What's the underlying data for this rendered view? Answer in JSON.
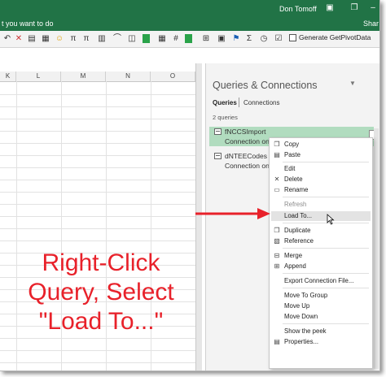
{
  "window": {
    "user_name": "Don Tomoff",
    "tell_me": "t you want to do",
    "share_label": "Shar",
    "colors": {
      "excel_green": "#217346",
      "selection_green": "#b1dcbf",
      "annotation_red": "#e8212a"
    }
  },
  "toolbar": {
    "generate_pivot_label": "Generate GetPivotData",
    "icons": [
      "undo-icon",
      "pi-icon",
      "format-icon",
      "smiley-icon",
      "pi-equation-icon",
      "column-icon",
      "link-icon",
      "chart-icon",
      "color-icon",
      "table-icon",
      "number-icon",
      "grid-icon",
      "flag-icon",
      "sum-icon",
      "clock-icon",
      "lasso-icon",
      "check-icon"
    ]
  },
  "grid": {
    "columns": [
      "K",
      "L",
      "M",
      "N",
      "O"
    ]
  },
  "annotation": {
    "line1": "Right-Click",
    "line2": "Query, Select",
    "line3": "\"Load To...\""
  },
  "pane": {
    "title": "Queries & Connections",
    "tabs": {
      "queries": "Queries",
      "connections": "Connections"
    },
    "count": "2 queries",
    "items": [
      {
        "name": "fNCCSImport",
        "status": "Connection on"
      },
      {
        "name": "dNTEECodes",
        "status": "Connection on"
      }
    ]
  },
  "menu": {
    "items": [
      {
        "label": "Copy",
        "icon": "copy-icon"
      },
      {
        "label": "Paste",
        "icon": "paste-icon"
      },
      {
        "label": "Edit",
        "icon": ""
      },
      {
        "label": "Delete",
        "icon": "delete-icon"
      },
      {
        "label": "Rename",
        "icon": "rename-icon"
      },
      {
        "label": "Refresh",
        "icon": ""
      },
      {
        "label": "Load To...",
        "icon": ""
      },
      {
        "label": "Duplicate",
        "icon": "duplicate-icon"
      },
      {
        "label": "Reference",
        "icon": "reference-icon"
      },
      {
        "label": "Merge",
        "icon": "merge-icon"
      },
      {
        "label": "Append",
        "icon": "append-icon"
      },
      {
        "label": "Export Connection File...",
        "icon": ""
      },
      {
        "label": "Move To Group",
        "icon": ""
      },
      {
        "label": "Move Up",
        "icon": ""
      },
      {
        "label": "Move Down",
        "icon": ""
      },
      {
        "label": "Show the peek",
        "icon": ""
      },
      {
        "label": "Properties...",
        "icon": "properties-icon"
      }
    ]
  }
}
